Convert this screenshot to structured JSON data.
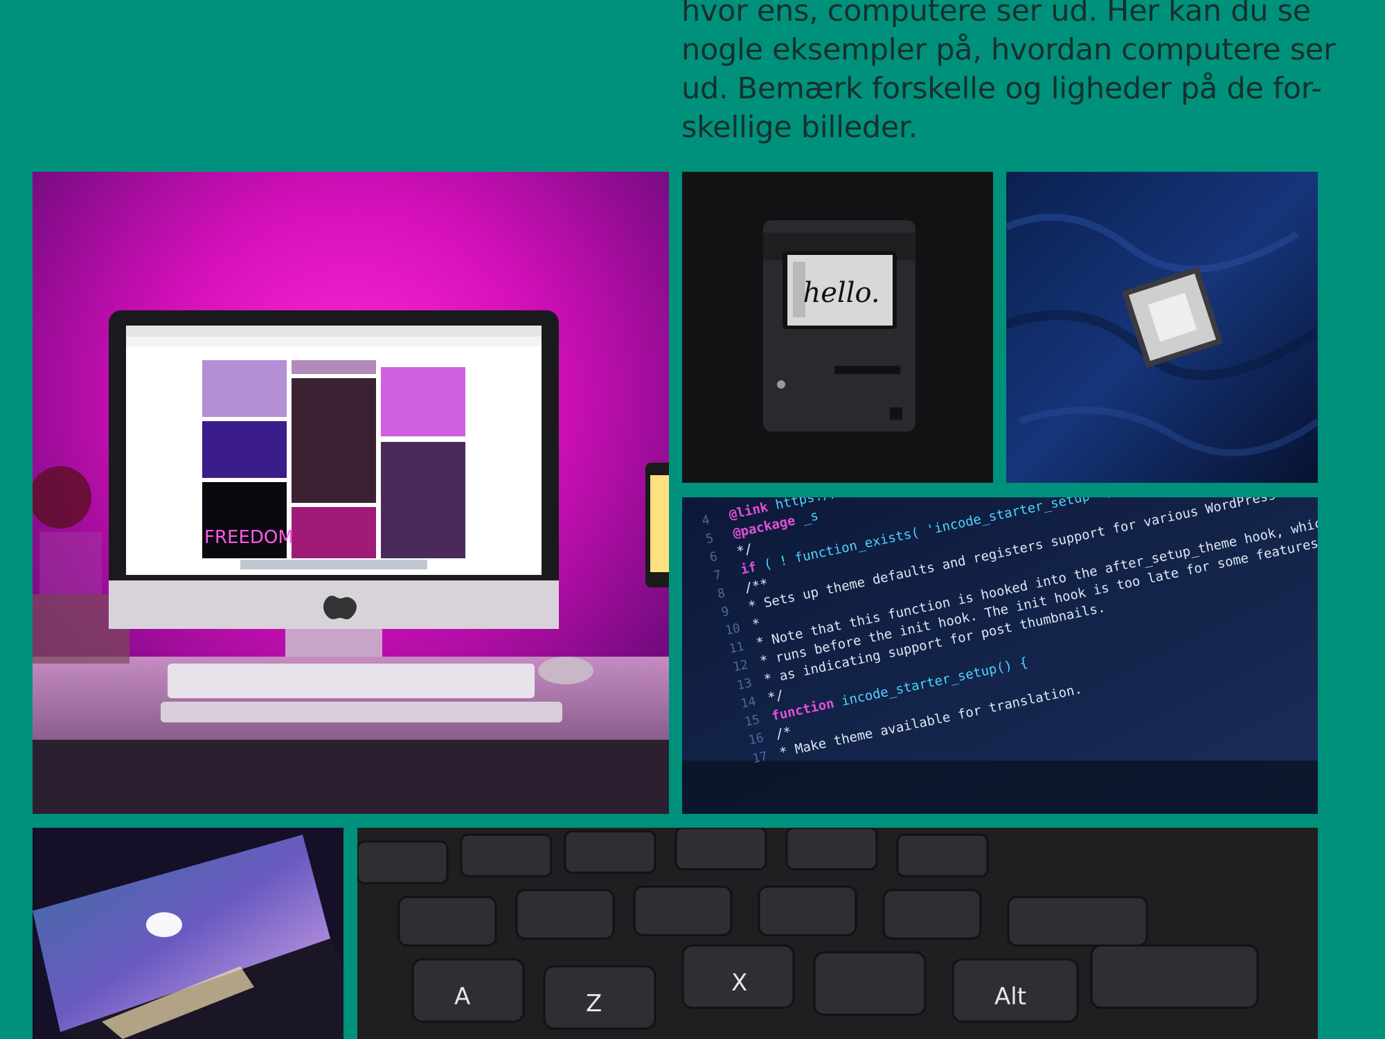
{
  "colors": {
    "page_background": "#00917c",
    "text": "#16302c",
    "code_keyword": "#e04fd8",
    "code_function": "#4fd3ff",
    "code_string": "#d6ff6a"
  },
  "intro": {
    "lines": [
      "hvor ens, computere ser ud. Her kan du se",
      "nogle eksempler på, hvordan computere ser",
      "ud. Bemærk forskelle og ligheder på de for-",
      "skellige billeder."
    ]
  },
  "photos": {
    "desk": {
      "neon_sign": "FREEDOM"
    },
    "retro_mac": {
      "screen_text": "hello."
    },
    "code": {
      "lines": [
        {
          "num": "4",
          "keyword": "@link",
          "text": " https://deve"
        },
        {
          "num": "5",
          "keyword": "@package",
          "text": " _s"
        },
        {
          "num": "6",
          "keyword": "",
          "text": "*/"
        },
        {
          "num": "7",
          "keyword": "if",
          "text": " ( ! function_exists( 'incode_starter_setup' ) ) :"
        },
        {
          "num": "8",
          "keyword": "",
          "text": "/**"
        },
        {
          "num": "9",
          "keyword": "",
          "text": " * Sets up theme defaults and registers support for various WordPress fea"
        },
        {
          "num": "10",
          "keyword": "",
          "text": " *"
        },
        {
          "num": "11",
          "keyword": "",
          "text": " * Note that this function is hooked into the after_setup_theme hook, which"
        },
        {
          "num": "12",
          "keyword": "",
          "text": " * runs before the init hook. The init hook is too late for some features, such"
        },
        {
          "num": "13",
          "keyword": "",
          "text": " * as indicating support for post thumbnails."
        },
        {
          "num": "14",
          "keyword": "",
          "text": " */"
        },
        {
          "num": "15",
          "keyword": "function",
          "text": " incode_starter_setup() {"
        },
        {
          "num": "16",
          "keyword": "",
          "text": "  /*"
        },
        {
          "num": "17",
          "keyword": "",
          "text": "   * Make theme available for translation."
        }
      ]
    },
    "keyboard": {
      "keys": [
        "A",
        "Z",
        "X",
        "Alt"
      ]
    }
  }
}
